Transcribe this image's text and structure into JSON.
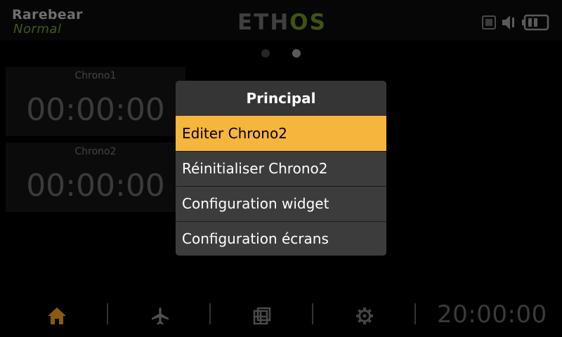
{
  "header": {
    "model_name": "Rarebear",
    "flight_mode": "Normal",
    "logo_left": "ETH",
    "logo_right": "OS"
  },
  "icons": {
    "status": [
      "sd-card-icon",
      "speaker-icon",
      "battery-icon"
    ],
    "nav": [
      "home-icon",
      "airplane-icon",
      "layout-icon",
      "gear-icon"
    ]
  },
  "pagination": {
    "total": 2,
    "current": 2
  },
  "widgets": [
    {
      "label": "Chrono1",
      "value": "00:00:00"
    },
    {
      "label": "Chrono2",
      "value": "00:00:00"
    }
  ],
  "menu": {
    "title": "Principal",
    "items": [
      "Editer Chrono2",
      "Réinitialiser Chrono2",
      "Configuration widget",
      "Configuration écrans"
    ],
    "selected_index": 0
  },
  "footer": {
    "clock": "20:00:00"
  },
  "colors": {
    "accent": "#f6b53c",
    "home_icon": "#8a5a12",
    "flight_mode": "#3e5a12"
  }
}
